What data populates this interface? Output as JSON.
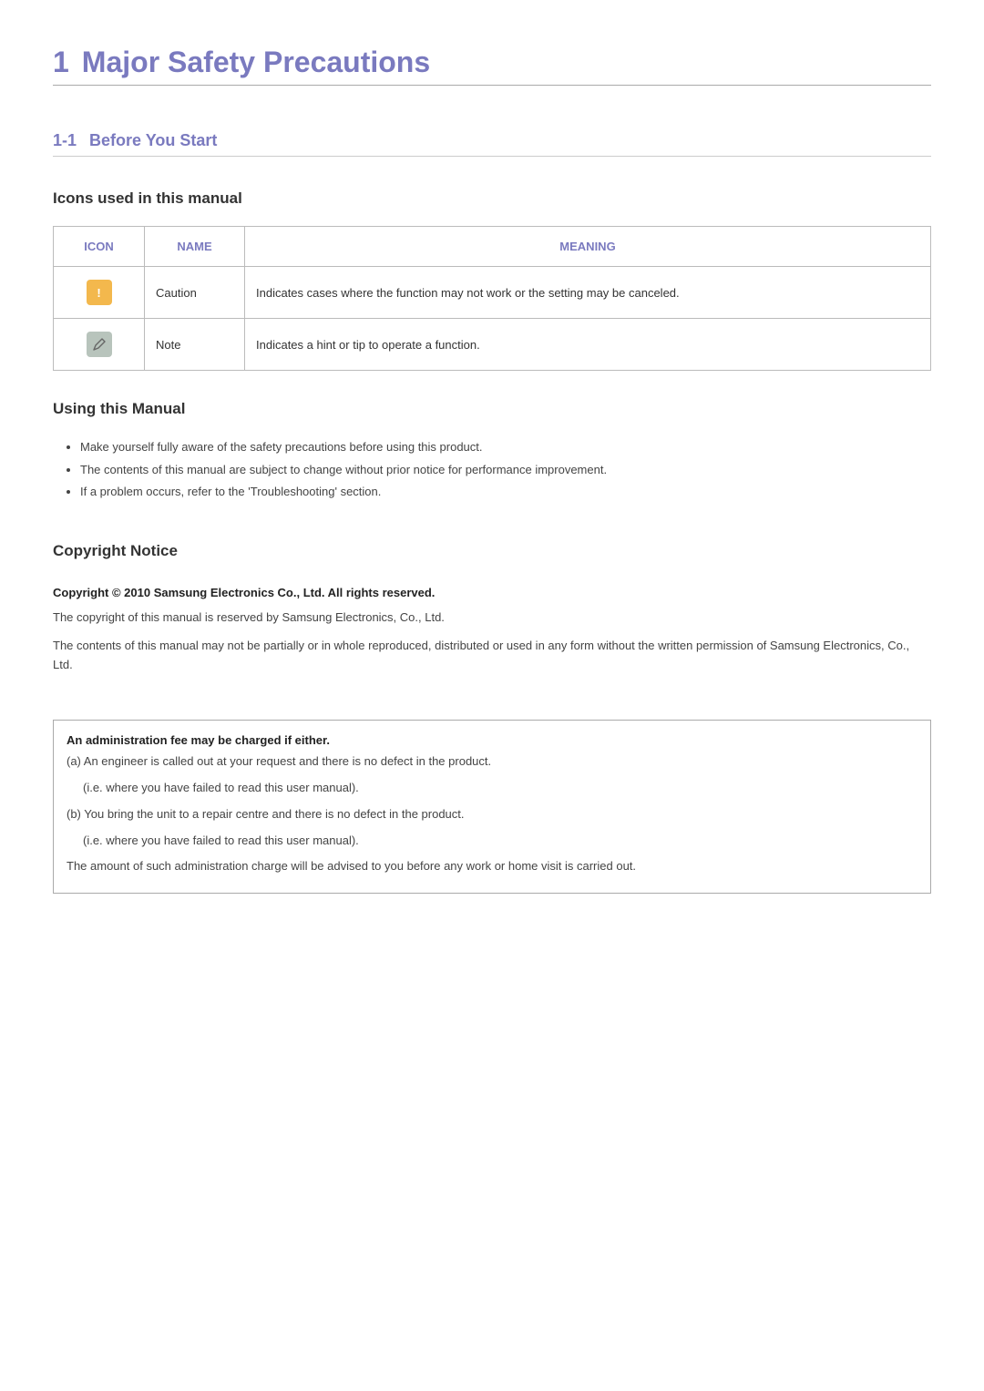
{
  "chapter": {
    "num": "1",
    "title": "Major Safety Precautions"
  },
  "section": {
    "num": "1-1",
    "title": "Before You Start"
  },
  "iconsTable": {
    "heading": "Icons used in this manual",
    "headers": {
      "icon": "ICON",
      "name": "NAME",
      "meaning": "MEANING"
    },
    "rows": [
      {
        "iconKind": "caution",
        "name": "Caution",
        "meaning": "Indicates cases where the function may not work or the setting may be canceled."
      },
      {
        "iconKind": "note",
        "name": "Note",
        "meaning": "Indicates a hint or tip to operate a function."
      }
    ]
  },
  "usingManual": {
    "heading": "Using this Manual",
    "items": [
      "Make yourself fully aware of the safety precautions before using this product.",
      "The contents of this manual are subject to change without prior notice for performance improvement.",
      "If a problem occurs, refer to the 'Troubleshooting' section."
    ]
  },
  "copyright": {
    "heading": "Copyright Notice",
    "boldLine": "Copyright © 2010 Samsung Electronics Co., Ltd. All rights reserved.",
    "p1": "The copyright of this manual is reserved by Samsung Electronics, Co., Ltd.",
    "p2": "The contents of this manual may not be partially or in whole reproduced, distributed or used in any form without the written permission of Samsung Electronics, Co., Ltd."
  },
  "feeBox": {
    "boldLine": "An administration fee may be charged if either.",
    "a": "(a) An engineer is called out at your request and there is no defect in the product.",
    "aSub": "(i.e. where you have failed to read this user manual).",
    "b": "(b) You bring the unit to a repair centre and there is no defect in the product.",
    "bSub": "(i.e. where you have failed to read this user manual).",
    "final": "The amount of such administration charge will be advised to you before any work or home visit is carried out."
  }
}
